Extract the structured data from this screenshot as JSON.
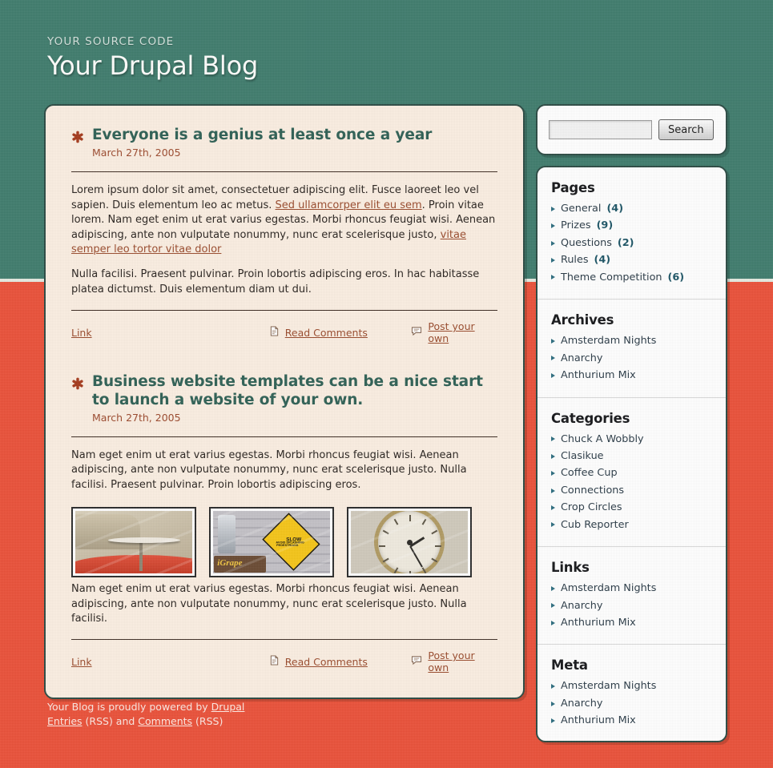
{
  "header": {
    "kicker": "YOUR SOURCE CODE",
    "title": "Your Drupal Blog"
  },
  "search": {
    "value": "",
    "placeholder": "",
    "button_label": "Search"
  },
  "posts": [
    {
      "title": "Everyone is a genius at least once a year",
      "date": "March 27th, 2005",
      "paragraphs": [
        "Lorem ipsum dolor sit amet, consectetuer adipiscing elit. Fusce laoreet leo vel sapien. Duis elementum leo ac metus. Sed ullamcorper elit eu sem. Proin vitae lorem. Nam eget enim ut erat varius egestas. Morbi rhoncus feugiat wisi. Aenean adipiscing, ante non vulputate nonummy, nunc erat scelerisque justo, vitae semper leo tortor vitae dolor",
        "Nulla facilisi. Praesent pulvinar. Proin lobortis adipiscing eros. In hac habitasse platea dictumst. Duis elementum diam ut dui."
      ],
      "meta": {
        "link_label": "Link",
        "comments_label": "Read Comments",
        "post_label": "Post your own"
      }
    },
    {
      "title": "Business website templates can be a nice start to launch a website of your own.",
      "date": "March 27th, 2005",
      "paragraphs": [
        "Nam eget enim ut erat varius egestas. Morbi rhoncus feugiat wisi. Aenean adipiscing, ante non vulputate nonummy, nunc erat scelerisque justo. Nulla facilisi. Praesent pulvinar. Proin lobortis adipiscing eros.",
        "Nam eget enim ut erat varius egestas. Morbi rhoncus feugiat wisi. Aenean adipiscing, ante non vulputate nonummy, nunc erat scelerisque justo. Nulla facilisi."
      ],
      "images": [
        {
          "alt": "diner booth with round table"
        },
        {
          "alt": "yellow road sign SLOW AVOID SPLASHING PEDESTRIANS",
          "sign_line1": "SLOW",
          "sign_line2": "AVOID SPLASHING",
          "sign_line3": "PEDESTRIANS",
          "crate_label": "iGrape"
        },
        {
          "alt": "brass clock face close up"
        }
      ],
      "meta": {
        "link_label": "Link",
        "comments_label": "Read Comments",
        "post_label": "Post your own"
      }
    }
  ],
  "sidebar": {
    "sections": [
      {
        "title": "Pages",
        "items": [
          {
            "label": "General",
            "count": "(4)"
          },
          {
            "label": "Prizes",
            "count": "(9)"
          },
          {
            "label": "Questions",
            "count": "(2)"
          },
          {
            "label": "Rules",
            "count": "(4)"
          },
          {
            "label": "Theme Competition",
            "count": "(6)"
          }
        ]
      },
      {
        "title": "Archives",
        "items": [
          {
            "label": "Amsterdam Nights",
            "count": ""
          },
          {
            "label": "Anarchy",
            "count": ""
          },
          {
            "label": "Anthurium Mix",
            "count": ""
          }
        ]
      },
      {
        "title": "Categories",
        "items": [
          {
            "label": "Chuck A Wobbly",
            "count": ""
          },
          {
            "label": "Clasikue",
            "count": ""
          },
          {
            "label": "Coffee Cup",
            "count": ""
          },
          {
            "label": "Connections",
            "count": ""
          },
          {
            "label": "Crop Circles",
            "count": ""
          },
          {
            "label": "Cub Reporter",
            "count": ""
          }
        ]
      },
      {
        "title": "Links",
        "items": [
          {
            "label": "Amsterdam Nights",
            "count": ""
          },
          {
            "label": "Anarchy",
            "count": ""
          },
          {
            "label": "Anthurium Mix",
            "count": ""
          }
        ]
      },
      {
        "title": "Meta",
        "items": [
          {
            "label": "Amsterdam Nights",
            "count": ""
          },
          {
            "label": "Anarchy",
            "count": ""
          },
          {
            "label": "Anthurium Mix",
            "count": ""
          }
        ]
      }
    ]
  },
  "footer": {
    "line1_prefix": "Your Blog is proudly powered by ",
    "drupal_label": "Drupal",
    "entries_label": "Entries",
    "entries_suffix": " (RSS) and ",
    "comments_label": "Comments",
    "comments_suffix": " (RSS)"
  },
  "colors": {
    "teal": "#3f7c6d",
    "red": "#ea5139",
    "cream": "#fbeee1",
    "title_green": "#2f6055",
    "link_brown": "#9a4b2d",
    "border_dark": "#2b4a43"
  }
}
